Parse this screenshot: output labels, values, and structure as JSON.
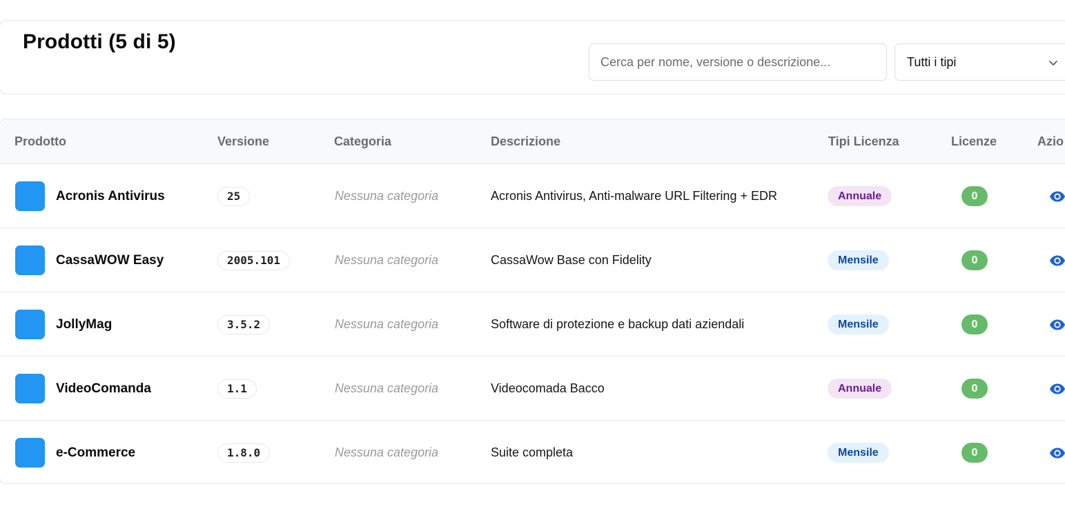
{
  "header": {
    "title": "Prodotti (5 di 5)",
    "search": {
      "placeholder": "Cerca per nome, versione o descrizione...",
      "value": ""
    },
    "type_filter": {
      "selected": "Tutti i tipi",
      "icon": "chevron-down-icon"
    }
  },
  "table": {
    "columns": [
      "Prodotto",
      "Versione",
      "Categoria",
      "Descrizione",
      "Tipi Licenza",
      "Licenze",
      "Azio"
    ],
    "rows": [
      {
        "name": "Acronis Antivirus",
        "version": "25",
        "category": "Nessuna categoria",
        "description": "Acronis Antivirus, Anti-malware URL Filtering + EDR",
        "license_type": "Annuale",
        "licenses": "0"
      },
      {
        "name": "CassaWOW Easy",
        "version": "2005.101",
        "category": "Nessuna categoria",
        "description": "CassaWow Base con Fidelity",
        "license_type": "Mensile",
        "licenses": "0"
      },
      {
        "name": "JollyMag",
        "version": "3.5.2",
        "category": "Nessuna categoria",
        "description": "Software di protezione e backup dati aziendali",
        "license_type": "Mensile",
        "licenses": "0"
      },
      {
        "name": "VideoComanda",
        "version": "1.1",
        "category": "Nessuna categoria",
        "description": "Videocomada Bacco",
        "license_type": "Annuale",
        "licenses": "0"
      },
      {
        "name": "e-Commerce",
        "version": "1.8.0",
        "category": "Nessuna categoria",
        "description": "Suite completa",
        "license_type": "Mensile",
        "licenses": "0"
      }
    ]
  },
  "colors": {
    "product_icon": "#2196f3",
    "annuale_bg": "#f3e5f5",
    "annuale_text": "#6a1b9a",
    "mensile_bg": "#e3f2fd",
    "mensile_text": "#0d47a1",
    "licenses_badge": "#66bb6a",
    "action_icon": "#1e63d6"
  },
  "icons": {
    "row_action": "eye-icon"
  }
}
